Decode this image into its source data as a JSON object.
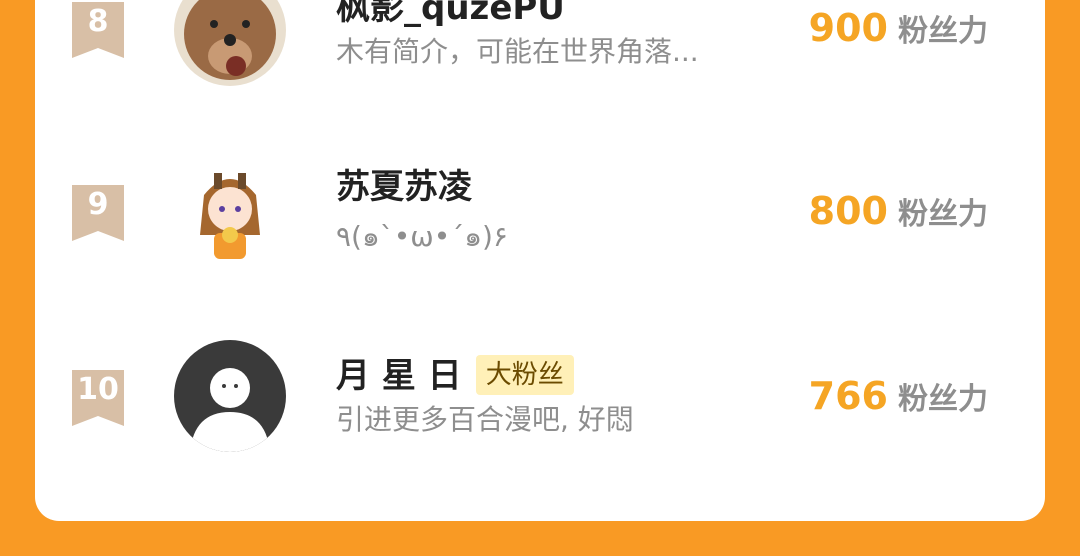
{
  "unit_label": "粉丝力",
  "rows": [
    {
      "rank": "8",
      "name": "枫影_quzePU",
      "bio": "木有简介，可能在世界角落...",
      "score": "900",
      "tag": ""
    },
    {
      "rank": "9",
      "name": "苏夏苏凌",
      "bio": "٩(๑`•ω•´๑)۶",
      "score": "800",
      "tag": ""
    },
    {
      "rank": "10",
      "name": "月 星 日",
      "bio": "引进更多百合漫吧, 好悶",
      "score": "766",
      "tag": "大粉丝"
    }
  ],
  "colors": {
    "background": "#F99A24",
    "score": "#F5A524",
    "badge": "#D8BFA6",
    "tag_bg": "#FFF0B8"
  },
  "icons": {
    "rank_badge": "ribbon-badge",
    "default_avatar": "person-silhouette"
  }
}
